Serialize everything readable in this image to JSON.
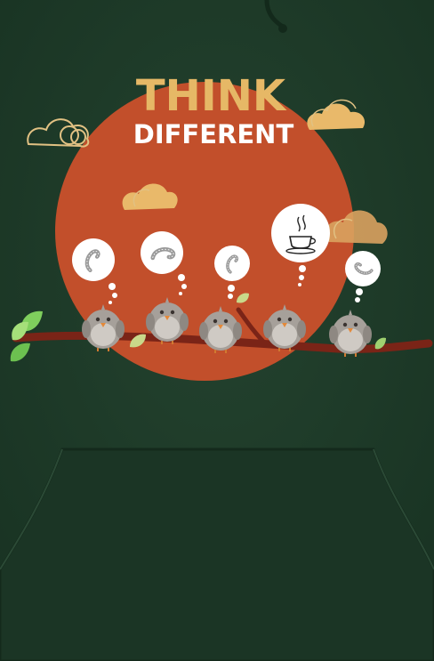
{
  "print": {
    "headline_line1": "THINK",
    "headline_line2": "DIFFERENT"
  },
  "colors": {
    "fabric": "#1f3a2a",
    "fabric_dark": "#17301f",
    "sun": "#c24f2b",
    "think_text": "#e6b866",
    "different_text": "#ffffff",
    "cloud": "#e9b96a",
    "cloud_outline": "#e1c183",
    "branch": "#7a2417",
    "bird_body": "#a6a09a",
    "bird_belly": "#cfcac4",
    "beak": "#e3893a",
    "leaf": "#7fcf5d",
    "bubble": "#ffffff"
  },
  "birds": [
    {
      "thought_icon": "worm-icon"
    },
    {
      "thought_icon": "worm-icon"
    },
    {
      "thought_icon": "worm-icon"
    },
    {
      "thought_icon": "coffee-cup-icon"
    },
    {
      "thought_icon": "worm-icon"
    }
  ]
}
